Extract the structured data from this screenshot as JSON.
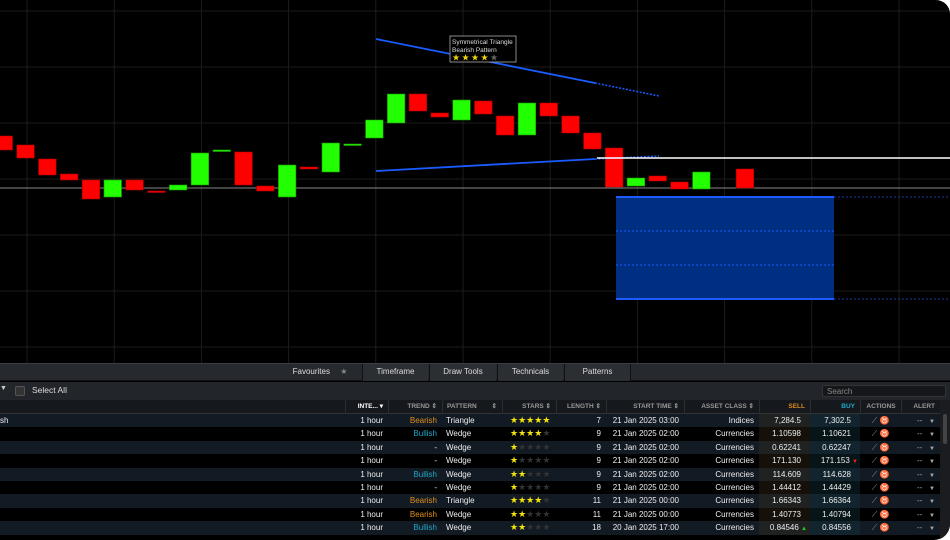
{
  "chart": {
    "colors": {
      "up": "#22ff00",
      "down": "#ff0000",
      "trendline": "#1a5cff",
      "zone": "#003087",
      "level": "#ffffff"
    },
    "pattern_label": {
      "title": "Symmetrical Triangle",
      "subtitle": "Bearish Pattern",
      "stars": 4,
      "max_stars": 5
    },
    "candles": [
      {
        "o": 150,
        "c": 136
      },
      {
        "o": 145,
        "c": 158
      },
      {
        "o": 159,
        "c": 175
      },
      {
        "o": 174,
        "c": 180
      },
      {
        "o": 180,
        "c": 199
      },
      {
        "o": 197,
        "c": 180,
        "up": true
      },
      {
        "o": 180,
        "c": 190
      },
      {
        "o": 191,
        "c": 192
      },
      {
        "o": 190,
        "c": 185,
        "up": true
      },
      {
        "o": 185,
        "c": 153,
        "up": true
      },
      {
        "o": 151,
        "c": 150,
        "up": true
      },
      {
        "o": 152,
        "c": 185
      },
      {
        "o": 186,
        "c": 191
      },
      {
        "o": 197,
        "c": 165,
        "up": true
      },
      {
        "o": 167,
        "c": 169
      },
      {
        "o": 172,
        "c": 143,
        "up": true
      },
      {
        "o": 145,
        "c": 144,
        "up": true
      },
      {
        "o": 138,
        "c": 120,
        "up": true
      },
      {
        "o": 123,
        "c": 94,
        "up": true
      },
      {
        "o": 94,
        "c": 111
      },
      {
        "o": 113,
        "c": 117
      },
      {
        "o": 120,
        "c": 100,
        "up": true
      },
      {
        "o": 101,
        "c": 114
      },
      {
        "o": 116,
        "c": 135
      },
      {
        "o": 135,
        "c": 103,
        "up": true
      },
      {
        "o": 103,
        "c": 116
      },
      {
        "o": 116,
        "c": 133
      },
      {
        "o": 133,
        "c": 149
      },
      {
        "o": 148,
        "c": 187
      },
      {
        "o": 186,
        "c": 178,
        "up": true
      },
      {
        "o": 176,
        "c": 181
      },
      {
        "o": 182,
        "c": 189
      },
      {
        "o": 189,
        "c": 172,
        "up": true
      },
      null,
      {
        "o": 169,
        "c": 188
      }
    ]
  },
  "toolbar": {
    "tabs": [
      "Favourites",
      "Timeframe",
      "Draw Tools",
      "Technicals",
      "Patterns"
    ]
  },
  "filter": {
    "select_all": "Select All",
    "search_placeholder": "Search"
  },
  "table": {
    "headers": {
      "interval": "INTE...",
      "trend": "TREND",
      "pattern": "PATTERN",
      "stars": "STARS",
      "length": "LENGTH",
      "start_time": "START TIME",
      "asset_class": "ASSET CLASS",
      "sell": "SELL",
      "buy": "BUY",
      "actions": "ACTIONS",
      "alert": "ALERT"
    },
    "colors": {
      "sell": "#d98a1a",
      "buy": "#1fa8c9"
    },
    "rows": [
      {
        "name": "sh",
        "interval": "1 hour",
        "trend": "Bearish",
        "pattern": "Triangle",
        "stars": 5,
        "length": "7",
        "start_time": "21 Jan 2025 03:00",
        "asset_class": "Indices",
        "sell": "7,284.5",
        "buy": "7,302.5",
        "alert": "--"
      },
      {
        "name": "",
        "interval": "1 hour",
        "trend": "Bullish",
        "pattern": "Wedge",
        "stars": 4,
        "length": "9",
        "start_time": "21 Jan 2025 02:00",
        "asset_class": "Currencies",
        "sell": "1.10598",
        "buy": "1.10621",
        "alert": "--"
      },
      {
        "name": "",
        "interval": "1 hour",
        "trend": "-",
        "pattern": "Wedge",
        "stars": 1,
        "length": "9",
        "start_time": "21 Jan 2025 02:00",
        "asset_class": "Currencies",
        "sell": "0.62241",
        "buy": "0.62247",
        "alert": "--"
      },
      {
        "name": "",
        "interval": "1 hour",
        "trend": "-",
        "pattern": "Wedge",
        "stars": 1,
        "length": "9",
        "start_time": "21 Jan 2025 02:00",
        "asset_class": "Currencies",
        "sell": "171.130",
        "buy": "171.153",
        "buy_tick": "down",
        "alert": "--"
      },
      {
        "name": "",
        "interval": "1 hour",
        "trend": "Bullish",
        "pattern": "Wedge",
        "stars": 2,
        "length": "9",
        "start_time": "21 Jan 2025 02:00",
        "asset_class": "Currencies",
        "sell": "114.609",
        "buy": "114.628",
        "alert": "--"
      },
      {
        "name": "",
        "interval": "1 hour",
        "trend": "-",
        "pattern": "Wedge",
        "stars": 1,
        "length": "9",
        "start_time": "21 Jan 2025 02:00",
        "asset_class": "Currencies",
        "sell": "1.44412",
        "buy": "1.44429",
        "alert": "--"
      },
      {
        "name": "",
        "interval": "1 hour",
        "trend": "Bearish",
        "pattern": "Triangle",
        "stars": 4,
        "length": "11",
        "start_time": "21 Jan 2025 00:00",
        "asset_class": "Currencies",
        "sell": "1.66343",
        "buy": "1.66364",
        "alert": "--"
      },
      {
        "name": "",
        "interval": "1 hour",
        "trend": "Bearish",
        "pattern": "Wedge",
        "stars": 2,
        "length": "11",
        "start_time": "21 Jan 2025 00:00",
        "asset_class": "Currencies",
        "sell": "1.40773",
        "buy": "1.40794",
        "alert": "--"
      },
      {
        "name": "",
        "interval": "1 hour",
        "trend": "Bullish",
        "pattern": "Wedge",
        "stars": 2,
        "length": "18",
        "start_time": "20 Jan 2025 17:00",
        "asset_class": "Currencies",
        "sell": "0.84546",
        "sell_tick": "up",
        "buy": "0.84556",
        "alert": "--"
      }
    ]
  }
}
